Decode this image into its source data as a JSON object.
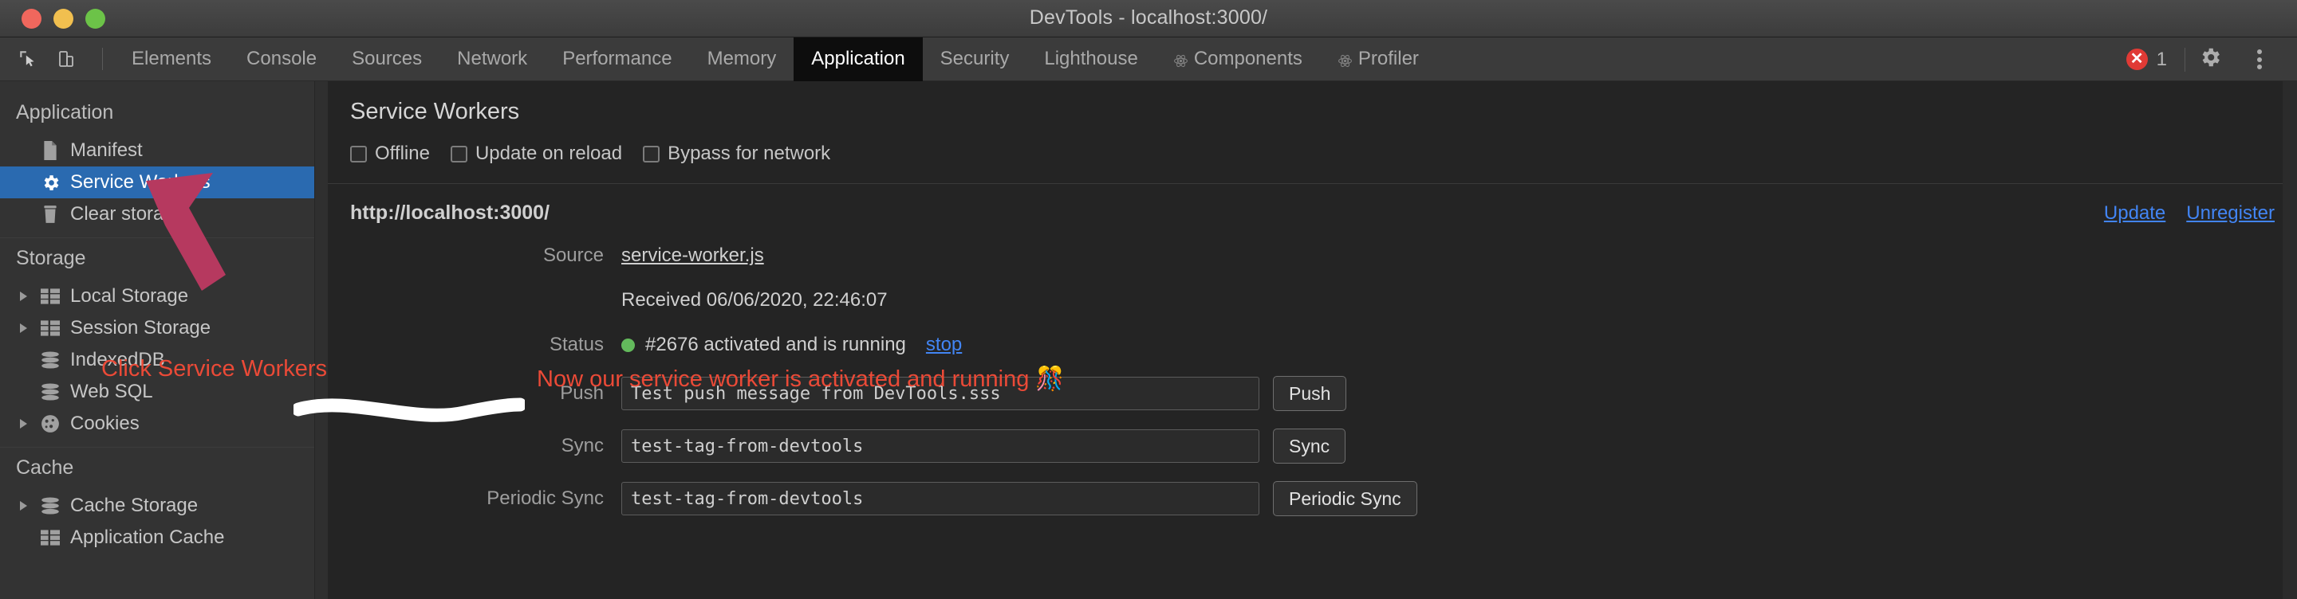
{
  "window": {
    "title": "DevTools - localhost:3000/",
    "traffic_lights": [
      "close-red",
      "minimize-yellow",
      "maximize-green"
    ]
  },
  "toolbar": {
    "left_icons": [
      "inspect-element-icon",
      "device-toolbar-icon"
    ],
    "tabs": [
      {
        "label": "Elements",
        "active": false,
        "icon": ""
      },
      {
        "label": "Console",
        "active": false,
        "icon": ""
      },
      {
        "label": "Sources",
        "active": false,
        "icon": ""
      },
      {
        "label": "Network",
        "active": false,
        "icon": ""
      },
      {
        "label": "Performance",
        "active": false,
        "icon": ""
      },
      {
        "label": "Memory",
        "active": false,
        "icon": ""
      },
      {
        "label": "Application",
        "active": true,
        "icon": ""
      },
      {
        "label": "Security",
        "active": false,
        "icon": ""
      },
      {
        "label": "Lighthouse",
        "active": false,
        "icon": ""
      },
      {
        "label": "Components",
        "active": false,
        "icon": "react-atom-icon"
      },
      {
        "label": "Profiler",
        "active": false,
        "icon": "react-atom-icon"
      }
    ],
    "error_count": "1",
    "settings_icon": "gear-icon",
    "more_icon": "three-dots-icon"
  },
  "sidebar": {
    "groups": [
      {
        "title": "Application",
        "items": [
          {
            "label": "Manifest",
            "icon": "document-icon",
            "selected": false,
            "expandable": false
          },
          {
            "label": "Service Workers",
            "icon": "gear-icon",
            "selected": true,
            "expandable": false
          },
          {
            "label": "Clear storage",
            "icon": "trash-icon",
            "selected": false,
            "expandable": false
          }
        ]
      },
      {
        "title": "Storage",
        "items": [
          {
            "label": "Local Storage",
            "icon": "table-icon",
            "selected": false,
            "expandable": true
          },
          {
            "label": "Session Storage",
            "icon": "table-icon",
            "selected": false,
            "expandable": true
          },
          {
            "label": "IndexedDB",
            "icon": "database-icon",
            "selected": false,
            "expandable": false
          },
          {
            "label": "Web SQL",
            "icon": "database-icon",
            "selected": false,
            "expandable": false
          },
          {
            "label": "Cookies",
            "icon": "cookie-icon",
            "selected": false,
            "expandable": true
          }
        ]
      },
      {
        "title": "Cache",
        "items": [
          {
            "label": "Cache Storage",
            "icon": "database-icon",
            "selected": false,
            "expandable": true
          },
          {
            "label": "Application Cache",
            "icon": "table-icon",
            "selected": false,
            "expandable": false
          }
        ]
      }
    ]
  },
  "main": {
    "panel_title": "Service Workers",
    "checkboxes": [
      {
        "label": "Offline",
        "checked": false
      },
      {
        "label": "Update on reload",
        "checked": false
      },
      {
        "label": "Bypass for network",
        "checked": false
      }
    ],
    "registration": {
      "scope_url": "http://localhost:3000/",
      "update_label": "Update",
      "unregister_label": "Unregister",
      "source_label": "Source",
      "source_file": "service-worker.js",
      "received_text": "Received 06/06/2020, 22:46:07",
      "status_label": "Status",
      "status_text": "#2676 activated and is running",
      "status_color": "#63ba5c",
      "stop_label": "stop"
    },
    "rows": [
      {
        "label": "Push",
        "value": "Test push message from DevTools.sss",
        "button": "Push"
      },
      {
        "label": "Sync",
        "value": "test-tag-from-devtools",
        "button": "Sync"
      },
      {
        "label": "Periodic Sync",
        "value": "test-tag-from-devtools",
        "button": "Periodic Sync"
      }
    ]
  },
  "annotations": {
    "arrow_color": "#b6395f",
    "click_hint": "Click Service Workers",
    "running_note": "Now our service worker is activated and running 🎊",
    "note_color": "#eb4a37",
    "scribble_color": "#ffffff"
  }
}
